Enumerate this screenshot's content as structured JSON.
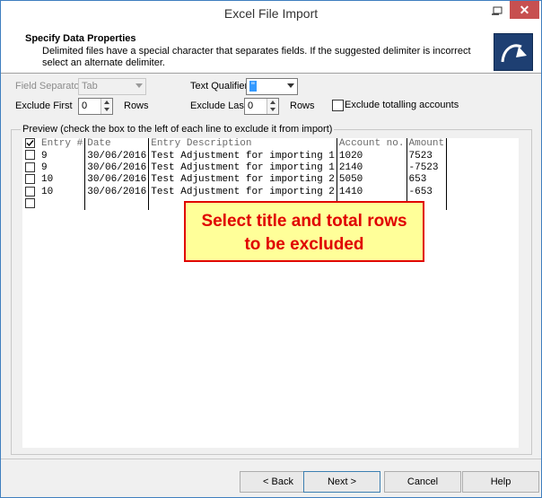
{
  "window": {
    "title": "Excel File Import",
    "close_glyph": "✕"
  },
  "header": {
    "title": "Specify Data Properties",
    "description": "Delimited files have a special character that separates fields. If the suggested delimiter is incorrect select an alternate delimiter.",
    "logo_icon": "curved-arrow-icon"
  },
  "options": {
    "field_separator_label": "Field Separator:",
    "field_separator_value": "Tab",
    "text_qualifier_label": "Text Qualifier:",
    "text_qualifier_value": "\"",
    "exclude_first_label": "Exclude First",
    "exclude_first_value": "0",
    "exclude_first_unit": "Rows",
    "exclude_last_label": "Exclude Last",
    "exclude_last_value": "0",
    "exclude_last_unit": "Rows",
    "exclude_totalling_label": "Exclude totalling accounts"
  },
  "preview": {
    "label": "Preview (check the box to the left of each line to exclude it from import)",
    "columns": [
      "Entry #",
      "Date",
      "Entry Description",
      "Account no.",
      "Amount"
    ],
    "rows": [
      [
        "9",
        "30/06/2016",
        "Test Adjustment for importing 1",
        "1020",
        "7523"
      ],
      [
        "9",
        "30/06/2016",
        "Test Adjustment for importing 1",
        "2140",
        "-7523"
      ],
      [
        "10",
        "30/06/2016",
        "Test Adjustment for importing 2",
        "5050",
        "653"
      ],
      [
        "10",
        "30/06/2016",
        "Test Adjustment for importing 2",
        "1410",
        "-653"
      ]
    ],
    "callout_line1": "Select title and total rows",
    "callout_line2": "to be excluded"
  },
  "buttons": {
    "back": "< Back",
    "next": "Next >",
    "cancel": "Cancel",
    "help": "Help"
  },
  "colors": {
    "accent": "#3399ff",
    "callout_fill": "#ffff99",
    "callout_text": "#e00000",
    "close": "#c75050"
  }
}
